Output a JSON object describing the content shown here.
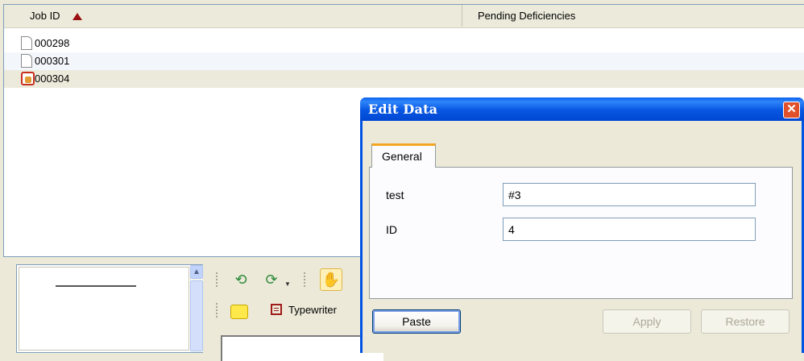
{
  "job_list": {
    "columns": [
      {
        "label": "Job ID",
        "sort": "ascending"
      },
      {
        "label": "Pending Deficiencies"
      }
    ],
    "rows": [
      {
        "job_id": "000298",
        "icon": "document-icon"
      },
      {
        "job_id": "000301",
        "icon": "document-icon"
      },
      {
        "job_id": "000304",
        "icon": "document-flagged-icon"
      }
    ]
  },
  "toolbar": {
    "typewriter_label": "Typewriter"
  },
  "dialog": {
    "title": "Edit Data",
    "tab": "General",
    "fields": [
      {
        "label": "test",
        "value": "#3"
      },
      {
        "label": "ID",
        "value": "4"
      }
    ],
    "buttons": {
      "paste": "Paste",
      "apply": "Apply",
      "restore": "Restore"
    },
    "close_glyph": "✕"
  },
  "colors": {
    "titlebar": "#0054e3",
    "sort_arrow": "#9a0f0f",
    "tab_highlight": "#f4a623"
  }
}
